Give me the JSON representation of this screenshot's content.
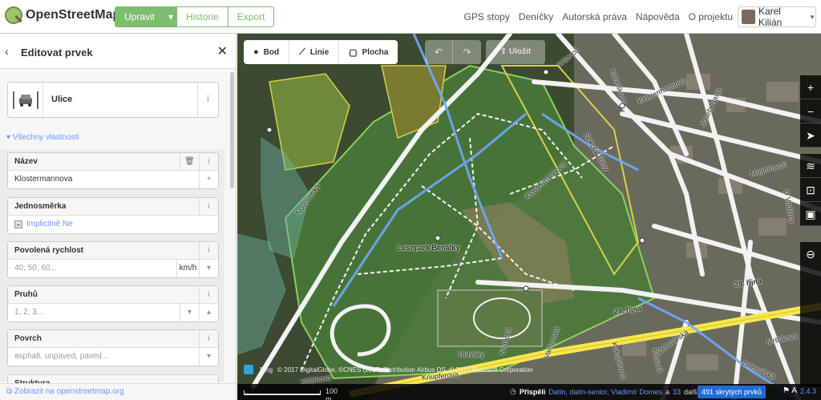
{
  "header": {
    "logo_text": "OpenStreetMap",
    "edit_button": "Upravit",
    "history_button": "Historie",
    "export_button": "Export",
    "nav_links": [
      "GPS stopy",
      "Deníčky",
      "Autorská práva",
      "Nápověda",
      "O projektu"
    ],
    "user_name": "Karel Kilián"
  },
  "sidebar": {
    "title": "Editovat prvek",
    "preset_name": "Ulice",
    "all_properties_toggle": "Všechny vlastnosti",
    "fields": {
      "name": {
        "label": "Název",
        "value": "Klostermannova"
      },
      "oneway": {
        "label": "Jednosměrka",
        "value": "Implicitně Ne"
      },
      "maxspeed": {
        "label": "Povolená rychlost",
        "placeholder": "40, 50, 60...",
        "unit": "km/h"
      },
      "lanes": {
        "label": "Pruhů",
        "placeholder": "1, 2, 3..."
      },
      "surface": {
        "label": "Povrch",
        "placeholder": "asphalt, unpaved, paved..."
      },
      "next_label": "Struktura"
    },
    "footer_link": "Zobrazit na openstreetmap.org"
  },
  "map": {
    "toolbar": {
      "point": "Bod",
      "line": "Linie",
      "area": "Plocha",
      "save": "Uložit"
    },
    "labels": {
      "park": "Lesopark Benátky",
      "bus_stop": "Hulváky"
    },
    "streets": [
      "Novoveská",
      "Klostermannova",
      "Sokola Tůmy",
      "Vršovců",
      "Kubelíkova",
      "Klostermannova",
      "Josefa Šavla",
      "Mojmírovců",
      "U Vodárny",
      "28. října",
      "28. října",
      "Zelenářská",
      "Mrštíkova",
      "Zelenářská",
      "Kukučínova",
      "Klínová",
      "Varšavská",
      "Nivnická",
      "Křižíkova",
      "Knüpferova"
    ],
    "attribution": "© 2017 DigitalGlobe, ©CNES (2017) Distribution Airbus DS, © 2017 Microsoft Corporation",
    "attribution_brand": "Bing",
    "scale_label": "100 m",
    "contributors_label": "Přispěli",
    "contributors": "Datin, datin-senior, Vladimír Domes",
    "contributors_more_prefix": "a",
    "contributors_more_count": "33",
    "contributors_more_suffix": "další",
    "hidden_features": "491 skrytých prvků",
    "version": "2.4.3"
  },
  "colors": {
    "accent_green": "#7ebc6f",
    "link_blue": "#7092ff",
    "road_yellow": "#f7e74b",
    "park_green": "#8cd05f",
    "hidden_badge": "#1e6bd6"
  }
}
